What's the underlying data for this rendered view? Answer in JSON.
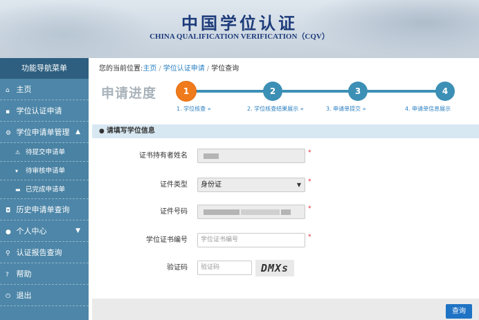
{
  "header": {
    "title_cn": "中国学位认证",
    "title_en": "CHINA QUALIFICATION VERIFICATION（CQV）"
  },
  "sidebar": {
    "menu_title": "功能导航菜单",
    "items": [
      {
        "label": "主页",
        "icon": "home-icon"
      },
      {
        "label": "学位认证申请",
        "icon": "file-icon"
      },
      {
        "label": "学位申请单管理",
        "icon": "gear-icon"
      },
      {
        "label": "历史申请单查询",
        "icon": "camera-icon"
      },
      {
        "label": "个人中心",
        "icon": "user-icon"
      },
      {
        "label": "认证报告查询",
        "icon": "search-icon"
      },
      {
        "label": "帮助",
        "icon": "help-icon"
      },
      {
        "label": "退出",
        "icon": "power-icon"
      }
    ],
    "sub_items": [
      {
        "label": "待提交申请单",
        "icon": "warning-icon"
      },
      {
        "label": "待审核申请单",
        "icon": "cart-icon"
      },
      {
        "label": "已完成申请单",
        "icon": "briefcase-icon"
      }
    ]
  },
  "breadcrumb": {
    "prefix": "您的当前位置:",
    "items": [
      "主页",
      "学位认证申请",
      "学位查询"
    ]
  },
  "progress": {
    "title": "申请进度",
    "current_step": 1,
    "steps": [
      {
        "number": "1",
        "label": "1. 学位核查 »"
      },
      {
        "number": "2",
        "label": "2. 学位核查结果展示 »"
      },
      {
        "number": "3",
        "label": "3. 申请单提交 »"
      },
      {
        "number": "4",
        "label": "4. 申请单信息展示"
      }
    ],
    "colors": {
      "active": "#f07b1c",
      "inactive": "#3c8fb5"
    }
  },
  "form": {
    "section_title": "请填写学位信息",
    "holder_name_label": "证书持有者姓名",
    "id_type_label": "证件类型",
    "id_type_value": "身份证",
    "id_number_label": "证件号码",
    "degree_cert_label": "学位证书编号",
    "degree_cert_placeholder": "学位证书编号",
    "captcha_label": "验证码",
    "captcha_placeholder": "验证码",
    "captcha_text": "DMXs",
    "required_mark": "*"
  },
  "actions": {
    "query_label": "查询"
  }
}
